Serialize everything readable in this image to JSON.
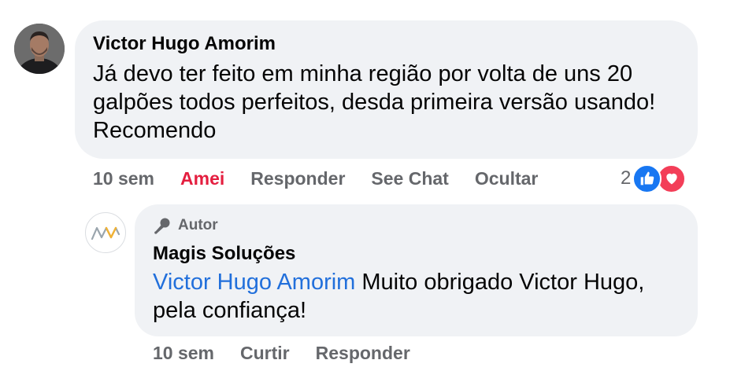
{
  "comment": {
    "author": "Victor Hugo Amorim",
    "text": "Já devo ter feito em minha região por volta de uns 20 galpões todos perfeitos, desda primeira versão usando! Recomendo",
    "time": "10 sem",
    "actions": {
      "reaction": "Amei",
      "reply": "Responder",
      "see_chat": "See Chat",
      "hide": "Ocultar"
    },
    "reactions": {
      "count": "2",
      "icons": [
        "like-icon",
        "love-icon"
      ],
      "like_color": "#1877f2",
      "love_color": "#f33e58"
    }
  },
  "reply": {
    "badge": "Autor",
    "author": "Magis Soluções",
    "mention": "Victor Hugo Amorim",
    "text": " Muito obrigado Victor Hugo, pela confiança!",
    "time": "10 sem",
    "actions": {
      "like": "Curtir",
      "reply": "Responder"
    }
  },
  "colors": {
    "bubble": "#f0f2f5",
    "meta_text": "#65676b",
    "love_text": "#e41e3f",
    "mention": "#216fdb"
  }
}
